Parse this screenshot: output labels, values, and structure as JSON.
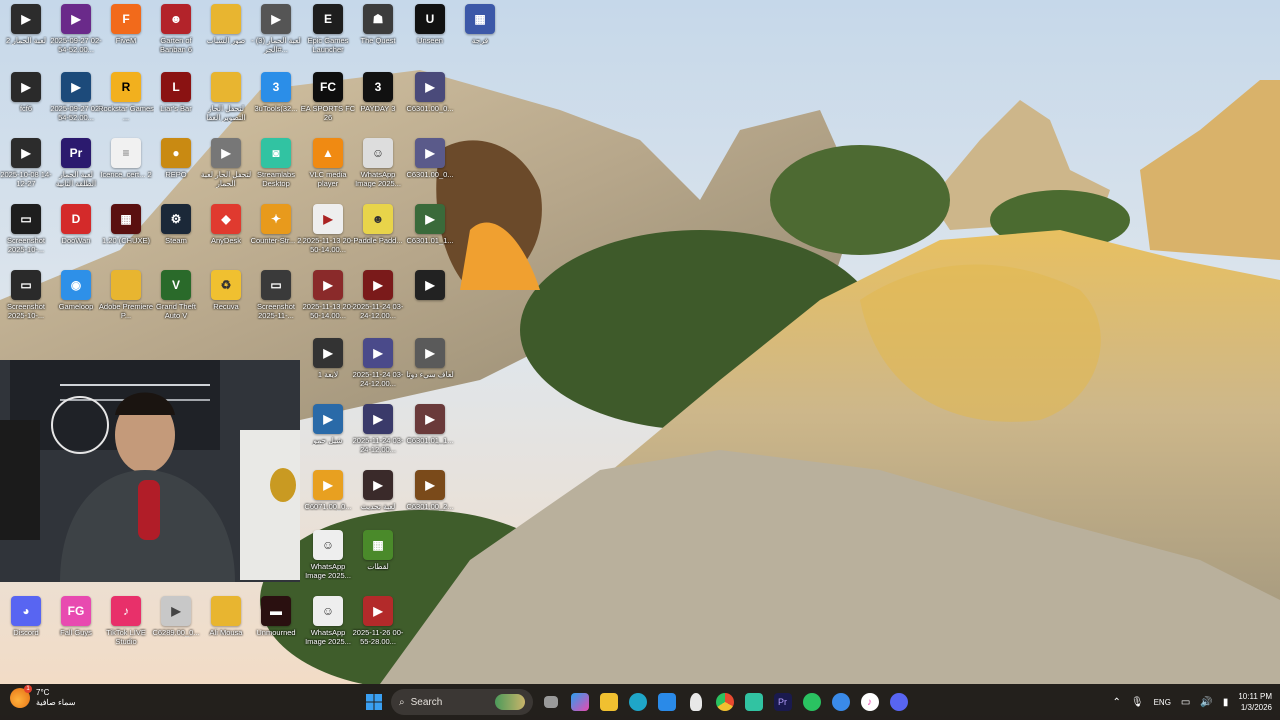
{
  "desktop_icons": [
    {
      "label": "لعبة الحمار 2",
      "color": "#2c2c2c"
    },
    {
      "label": "2025-09-27 02-54-52.00...",
      "color": "#6a2a8a"
    },
    {
      "label": "FiveM",
      "color": "#f26a1b"
    },
    {
      "label": "Garten of Banban 6",
      "color": "#b3232a"
    },
    {
      "label": "صور الشباب",
      "color": "#e8b530"
    },
    {
      "label": "لعبة الحمار (3) - #الجز...",
      "color": "#555555"
    },
    {
      "label": "Epic Games Launcher",
      "color": "#1e1e1e"
    },
    {
      "label": "The Quest",
      "color": "#3c3c3c"
    },
    {
      "label": "Unseen",
      "color": "#111111"
    },
    {
      "label": "فرجة",
      "color": "#3c58a8"
    },
    {
      "label": "fcf6",
      "color": "#2a2a2a"
    },
    {
      "label": "2025-09-27 02-54-52.00...",
      "color": "#1c4a7a"
    },
    {
      "label": "Rockstar Games ...",
      "color": "#f2b01e"
    },
    {
      "label": "Liar's Bar",
      "color": "#8a1212"
    },
    {
      "label": "لتحفل الحار التصوير الغفا",
      "color": "#e8b530"
    },
    {
      "label": "3uTools(32...",
      "color": "#2b8ee8"
    },
    {
      "label": "EA SPORTS FC 26",
      "color": "#0e0e0e"
    },
    {
      "label": "PAYDAY 3",
      "color": "#111111"
    },
    {
      "label": "C6301.00_0...",
      "color": "#4a4a7a"
    },
    {
      "label": "2025-10-08 14-12-27",
      "color": "#2c2c2c"
    },
    {
      "label": "لعبة الحمار الطلقة الثانية",
      "color": "#2b1a6e"
    },
    {
      "label": "Icence_cert... 2",
      "color": "#f1f1f1"
    },
    {
      "label": "REPO",
      "color": "#c98a12"
    },
    {
      "label": "لتحفل الحار لعبة الحمار",
      "color": "#777777"
    },
    {
      "label": "Streamlabs Desktop",
      "color": "#31c3a2"
    },
    {
      "label": "VLC media player",
      "color": "#f08a12"
    },
    {
      "label": "WhatsApp Image 2025...",
      "color": "#dddddd"
    },
    {
      "label": "C6301.00_0...",
      "color": "#5a5a8a"
    },
    {
      "label": "Screenshot 2025-10-...",
      "color": "#1e1e1e"
    },
    {
      "label": "DooWan",
      "color": "#d42a2a"
    },
    {
      "label": "1.20 (CHUXE)",
      "color": "#5a1010"
    },
    {
      "label": "Steam",
      "color": "#1b2838"
    },
    {
      "label": "AnyDesk",
      "color": "#e03a2f"
    },
    {
      "label": "Counter-Str... 2",
      "color": "#e89a1c"
    },
    {
      "label": "2025-11-13 20-50-14.00...",
      "color": "#eeeeee"
    },
    {
      "label": "Paddle Padd...",
      "color": "#e8d44a"
    },
    {
      "label": "C6301.01_1...",
      "color": "#3a6a3a"
    },
    {
      "label": "Screenshot 2025-10-...",
      "color": "#2a2a2a"
    },
    {
      "label": "Gameloop",
      "color": "#2e90e8"
    },
    {
      "label": "Adobe Premiere P...",
      "color": "#e8b530"
    },
    {
      "label": "Grand Theft Auto V",
      "color": "#2a6a2a"
    },
    {
      "label": "Recuva",
      "color": "#f0c030"
    },
    {
      "label": "Screenshot 2025-11-...",
      "color": "#3a3a3a"
    },
    {
      "label": "2025-11-13 20-50-14.00...",
      "color": "#8a2a2a"
    },
    {
      "label": "2025-11-24 03-24-12.00...",
      "color": "#7a1a1a"
    },
    {
      "label": "",
      "color": "#222222"
    },
    {
      "label": "لايعة 1",
      "color": "#333333"
    },
    {
      "label": "2025-11-24 03-24-12.00...",
      "color": "#4a4a8a"
    },
    {
      "label": "لعاف سيء دوتا",
      "color": "#5a5a5a"
    },
    {
      "label": "شيل حمو",
      "color": "#2a6aa8"
    },
    {
      "label": "2025-11-24 03-24-12.00...",
      "color": "#3a3a6a"
    },
    {
      "label": "C6301.01_1...",
      "color": "#6a3a3a"
    },
    {
      "label": "C6071.00_0...",
      "color": "#e8a020"
    },
    {
      "label": "لعبة تحديث",
      "color": "#3a2a2a"
    },
    {
      "label": "C6301.00_2...",
      "color": "#7a4a1a"
    },
    {
      "label": "WhatsApp Image 2025...",
      "color": "#eeeeee"
    },
    {
      "label": "لقطات",
      "color": "#4a8a2a"
    },
    {
      "label": "Discord",
      "color": "#5865f2"
    },
    {
      "label": "Fall Guys",
      "color": "#e84ab0"
    },
    {
      "label": "TikTok LIVE Studio",
      "color": "#e8306a"
    },
    {
      "label": "C6289.00_0...",
      "color": "#c8c8c8"
    },
    {
      "label": "Ali Mousa",
      "color": "#e8b530"
    },
    {
      "label": "Unmourned",
      "color": "#2a1010"
    },
    {
      "label": "WhatsApp Image 2025...",
      "color": "#eeeeee"
    },
    {
      "label": "2025-11-26 00-55-28.00...",
      "color": "#b32a2a"
    }
  ],
  "taskbar": {
    "weather_temp": "7°C",
    "weather_desc": "سماء صافية",
    "weather_badge": "1",
    "search_placeholder": "Search",
    "language": "ENG",
    "time": "10:11 PM",
    "date": "1/3/2026",
    "apps": [
      {
        "name": "task-view",
        "color": "#9a9a9a"
      },
      {
        "name": "copilot",
        "color": "#7a5af0"
      },
      {
        "name": "file-explorer",
        "color": "#f0c030"
      },
      {
        "name": "edge",
        "color": "#1fa6c8"
      },
      {
        "name": "store",
        "color": "#2a8ae8"
      },
      {
        "name": "ghost-app",
        "color": "#e8e8e8"
      },
      {
        "name": "chrome",
        "color": "#e84a30"
      },
      {
        "name": "streamlabs",
        "color": "#31c3a2"
      },
      {
        "name": "premiere",
        "color": "#1a1a4e"
      },
      {
        "name": "whatsapp",
        "color": "#2ac261"
      },
      {
        "name": "camera-app",
        "color": "#3a8ae8"
      },
      {
        "name": "itunes",
        "color": "#e84ab0"
      },
      {
        "name": "discord",
        "color": "#5865f2"
      }
    ]
  }
}
